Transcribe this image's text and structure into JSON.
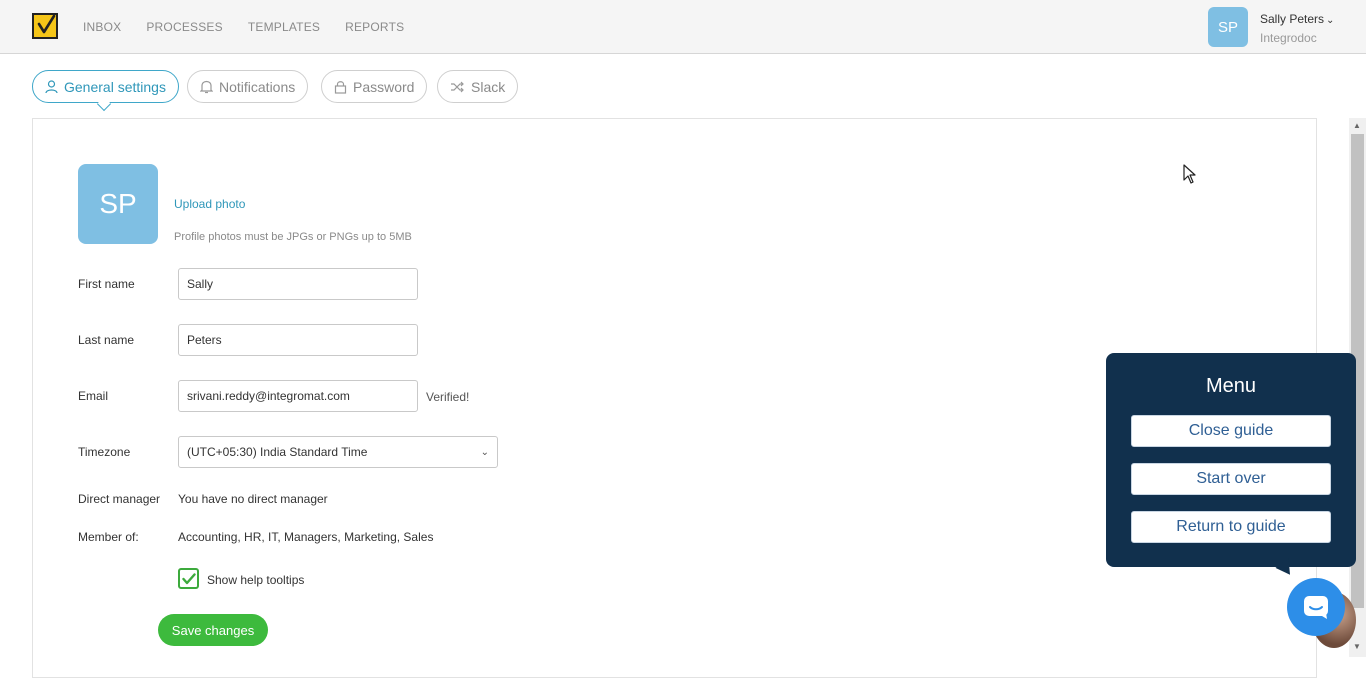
{
  "nav": {
    "items": [
      "INBOX",
      "PROCESSES",
      "TEMPLATES",
      "REPORTS"
    ]
  },
  "user": {
    "initials": "SP",
    "name": "Sally Peters",
    "org": "Integrodoc"
  },
  "tabs": [
    {
      "label": "General settings",
      "icon": "user-icon",
      "active": true
    },
    {
      "label": "Notifications",
      "icon": "bell-icon",
      "active": false
    },
    {
      "label": "Password",
      "icon": "lock-icon",
      "active": false
    },
    {
      "label": "Slack",
      "icon": "shuffle-icon",
      "active": false
    }
  ],
  "profile": {
    "initials": "SP",
    "upload_label": "Upload photo",
    "upload_hint": "Profile photos must be JPGs or PNGs up to 5MB"
  },
  "form": {
    "first_name_label": "First name",
    "first_name_value": "Sally",
    "last_name_label": "Last name",
    "last_name_value": "Peters",
    "email_label": "Email",
    "email_value": "srivani.reddy@integromat.com",
    "email_status": "Verified!",
    "timezone_label": "Timezone",
    "timezone_value": "(UTC+05:30) India Standard Time",
    "manager_label": "Direct manager",
    "manager_value": "You have no direct manager",
    "member_label": "Member of:",
    "member_value": "Accounting, HR, IT, Managers, Marketing, Sales",
    "tooltips_label": "Show help tooltips",
    "tooltips_checked": true,
    "save_label": "Save changes"
  },
  "guide": {
    "title": "Menu",
    "buttons": [
      "Close guide",
      "Start over",
      "Return to guide"
    ]
  },
  "colors": {
    "accent": "#2f97b9",
    "save": "#3dba3d",
    "guide_bg": "#11304d",
    "avatar": "#7fbfe3"
  }
}
